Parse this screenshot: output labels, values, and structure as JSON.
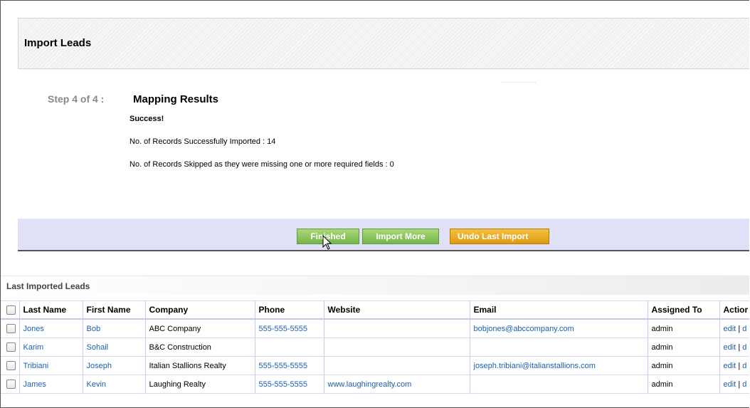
{
  "header": {
    "title": "Import Leads"
  },
  "step": {
    "label": "Step 4 of 4 :",
    "title": "Mapping Results",
    "status": "Success!",
    "imported_line": "No. of Records Successfully Imported : 14",
    "skipped_line": "No. of Records Skipped as they were missing one or more required fields : 0"
  },
  "buttons": {
    "finished": "Finished",
    "import_more": "Import More",
    "undo": "Undo Last Import"
  },
  "colors": {
    "green_button": "#76b54a",
    "orange_button": "#dd9a10",
    "button_bar": "#e0e0f8",
    "link": "#1a5fb4"
  },
  "last_imported": {
    "title": "Last Imported Leads",
    "columns": [
      "Last Name",
      "First Name",
      "Company",
      "Phone",
      "Website",
      "Email",
      "Assigned To",
      "Actior"
    ],
    "rows": [
      {
        "last": "Jones",
        "first": "Bob",
        "company": "ABC Company",
        "phone": "555-555-5555",
        "website": "",
        "email": "bobjones@abccompany.com",
        "assigned": "admin",
        "edit": "edit",
        "sep": "|",
        "del": "d"
      },
      {
        "last": "Karim",
        "first": "Sohail",
        "company": "B&C Construction",
        "phone": "",
        "website": "",
        "email": "",
        "assigned": "admin",
        "edit": "edit",
        "sep": "|",
        "del": "d"
      },
      {
        "last": "Tribiani",
        "first": "Joseph",
        "company": "Italian Stallions Realty",
        "phone": "555-555-5555",
        "website": "",
        "email": "joseph.tribiani@italianstallions.com",
        "assigned": "admin",
        "edit": "edit",
        "sep": "|",
        "del": "d"
      },
      {
        "last": "James",
        "first": "Kevin",
        "company": "Laughing Realty",
        "phone": "555-555-5555",
        "website": "www.laughingrealty.com",
        "email": "",
        "assigned": "admin",
        "edit": "edit",
        "sep": "|",
        "del": "d"
      }
    ]
  }
}
